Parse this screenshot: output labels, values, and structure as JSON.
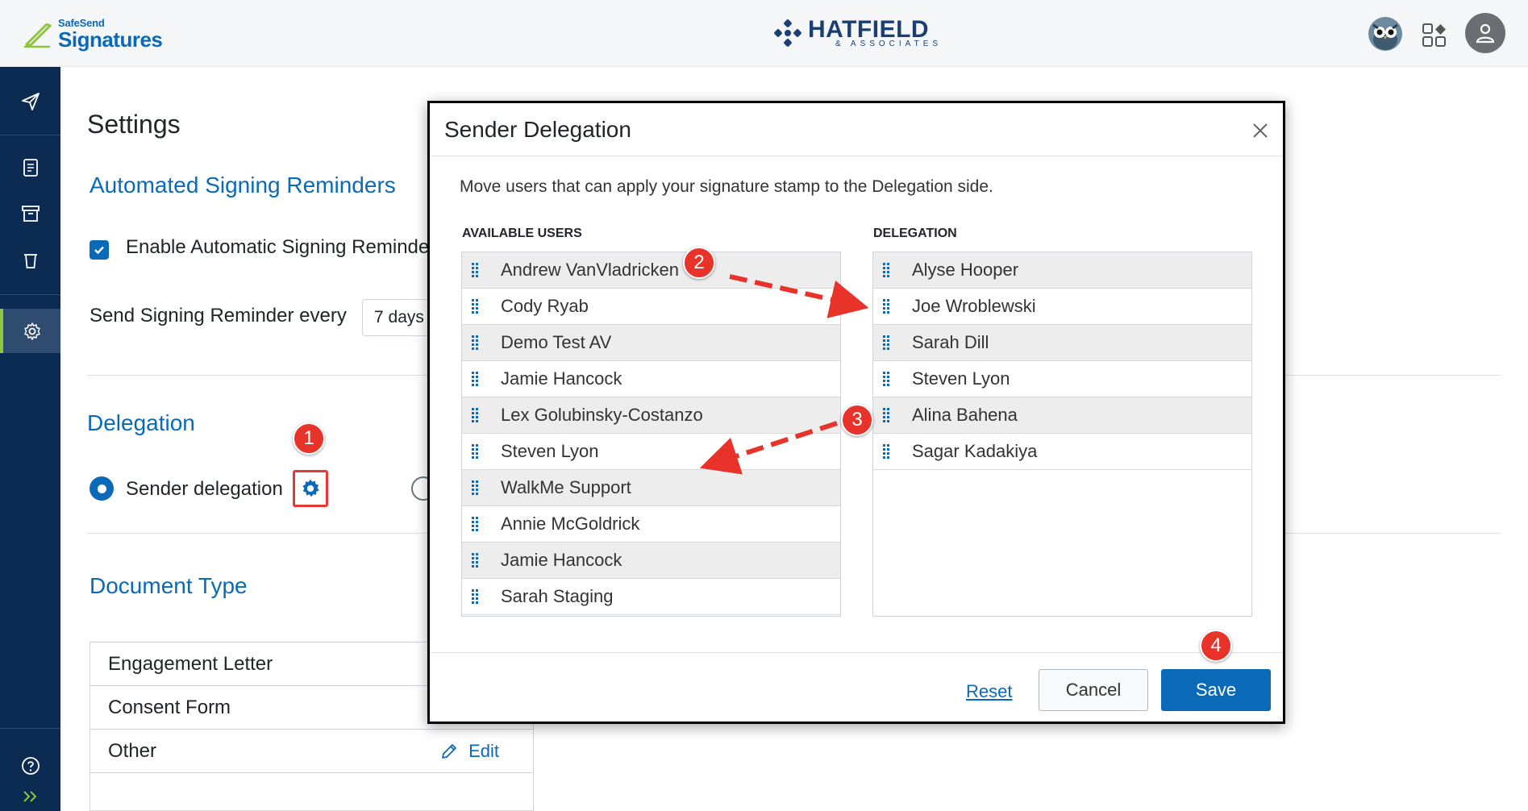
{
  "header": {
    "brand_small": "SafeSend",
    "brand_big": "Signatures",
    "company_name": "HATFIELD",
    "company_sub": "& ASSOCIATES",
    "icons": [
      "owl-avatar-icon",
      "apps-icon",
      "user-icon"
    ]
  },
  "sidebar": {
    "items": [
      "send-icon",
      "document-icon",
      "archive-icon",
      "recycle-bin-icon",
      "settings-icon",
      "help-icon",
      "expand-icon"
    ],
    "active": "settings-icon",
    "accent_color": "#8dc63f"
  },
  "settings": {
    "title": "Settings",
    "reminders": {
      "title": "Automated Signing Reminders",
      "enable_label": "Enable Automatic Signing Reminders",
      "enabled": true,
      "send_every_label": "Send Signing Reminder every",
      "interval_value": "7 days"
    },
    "delegation": {
      "title": "Delegation",
      "option_label": "Sender delegation",
      "selected": true
    },
    "document_type": {
      "title": "Document Type",
      "rows": [
        "Engagement Letter",
        "Consent Form",
        "Other"
      ],
      "edit_label": "Edit"
    }
  },
  "modal": {
    "title": "Sender Delegation",
    "description": "Move users that can apply your signature stamp to the Delegation side.",
    "available_header": "AVAILABLE USERS",
    "delegation_header": "DELEGATION",
    "available_users": [
      "Andrew VanVladricken",
      "Cody Ryab",
      "Demo Test AV",
      "Jamie Hancock",
      "Lex Golubinsky-Costanzo",
      "Steven Lyon",
      "WalkMe Support",
      "Annie McGoldrick",
      "Jamie Hancock",
      "Sarah Staging"
    ],
    "delegated_users": [
      "Alyse Hooper",
      "Joe Wroblewski",
      "Sarah Dill",
      "Steven Lyon",
      "Alina Bahena",
      "Sagar Kadakiya"
    ],
    "reset_label": "Reset",
    "cancel_label": "Cancel",
    "save_label": "Save"
  },
  "annotations": {
    "step1": "1",
    "step2": "2",
    "step3": "3",
    "step4": "4",
    "color": "#e8332b"
  },
  "colors": {
    "primary": "#0a6ab8",
    "sidebar": "#0c2b53"
  }
}
